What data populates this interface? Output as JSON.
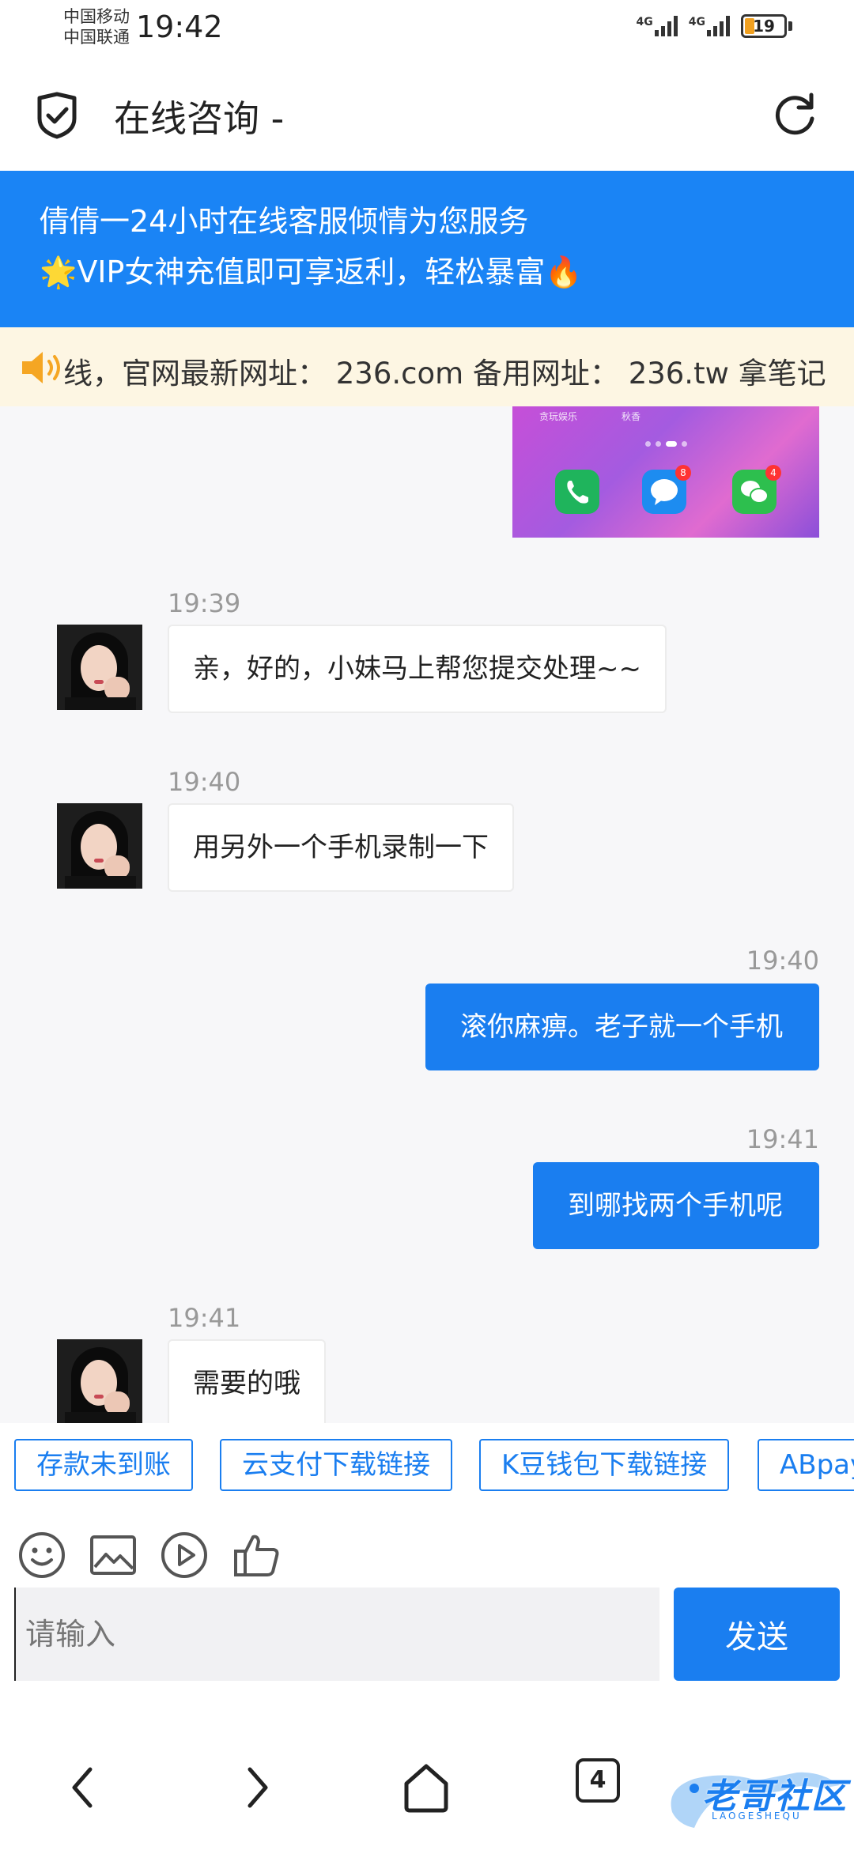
{
  "status_bar": {
    "carrier_1": "中国移动",
    "carrier_2": "中国联通",
    "time": "19:42",
    "network_1": "4G",
    "network_2": "4G",
    "battery": "19"
  },
  "header": {
    "title": "在线咨询 -"
  },
  "banner": {
    "line_1": "倩倩一24小时在线客服倾情为您服务",
    "line_2": "🌟VIP女神充值即可享返利，轻松暴富🔥"
  },
  "notice": {
    "text": "线，官网最新网址： 236.com 备用网址： 236.tw 拿笔记"
  },
  "screenshot_message": {
    "label_left": "贪玩娱乐",
    "label_right": "秋香",
    "messages_badge": "8",
    "wechat_badge": "4"
  },
  "messages": [
    {
      "time": "19:39",
      "text": "亲，好的，小妹马上帮您提交处理~~"
    },
    {
      "time": "19:40",
      "text": "用另外一个手机录制一下"
    },
    {
      "time": "19:40",
      "text": "滚你麻痹。老子就一个手机"
    },
    {
      "time": "19:41",
      "text": "到哪找两个手机呢"
    },
    {
      "time": "19:41",
      "text": "需要的哦"
    }
  ],
  "quick_replies": [
    "存款未到账",
    "云支付下载链接",
    "K豆钱包下载链接",
    "ABpay"
  ],
  "composer": {
    "placeholder": "请输入",
    "send_label": "发送"
  },
  "navbar": {
    "tab_count": "4"
  },
  "watermark": {
    "text": "老哥社区",
    "sub": "LAOGESHEQU"
  },
  "colors": {
    "primary": "#1a7ef0",
    "banner": "#1a84f5",
    "notice_bg": "#fdf6e3",
    "chat_bg": "#f7f7f9"
  }
}
